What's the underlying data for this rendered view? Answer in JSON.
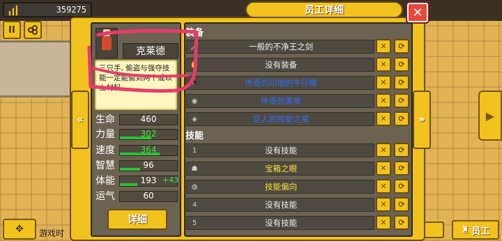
{
  "hud": {
    "money": "359275",
    "game_time_label": "游戏时"
  },
  "dialog": {
    "title": "员工详细",
    "close_label": "✕"
  },
  "employee": {
    "name": "克莱德",
    "description": "三只手, 偷盗与强夺技能一定能偷到两个或以上材料",
    "stats": [
      {
        "label": "生命",
        "value": "460",
        "value_color": "white",
        "level": 0.0
      },
      {
        "label": "力量",
        "value": "302",
        "value_color": "green",
        "level": 0.55
      },
      {
        "label": "速度",
        "value": "364",
        "value_color": "green",
        "level": 0.7
      },
      {
        "label": "智慧",
        "value": "96",
        "value_color": "white",
        "level": 0.35
      },
      {
        "label": "体能",
        "value": "193",
        "bonus": "+43",
        "value_color": "white",
        "level": 0.3
      },
      {
        "label": "运气",
        "value": "60",
        "value_color": "white",
        "level": 0.0
      }
    ],
    "detail_button": "详细"
  },
  "equipment": {
    "header": "装备",
    "items": [
      {
        "icon": "sword-icon",
        "name": "一般的不净王之剑",
        "color": "white"
      },
      {
        "icon": "glove-icon",
        "name": "没有装备",
        "color": "white"
      },
      {
        "icon": "hat-icon",
        "name": "传奇的印地的牛仔帽",
        "color": "blue"
      },
      {
        "icon": "belt-icon",
        "name": "传奇的黑带",
        "color": "blue"
      },
      {
        "icon": "ring-icon",
        "name": "巨人的技能之戒",
        "color": "blue"
      }
    ]
  },
  "skills": {
    "header": "技能",
    "items": [
      {
        "icon": "slot-1",
        "slot": "1",
        "name": "没有技能",
        "color": "white"
      },
      {
        "icon": "chest-eye-icon",
        "slot": "",
        "name": "宝箱之眼",
        "color": "yellow"
      },
      {
        "icon": "globe-icon",
        "slot": "",
        "name": "技能偏向",
        "color": "yellow"
      },
      {
        "icon": "slot-4",
        "slot": "4",
        "name": "没有技能",
        "color": "white"
      },
      {
        "icon": "slot-5",
        "slot": "5",
        "name": "没有技能",
        "color": "white"
      }
    ]
  },
  "buttons": {
    "remove_glyph": "✕",
    "swap_glyph": "⟳",
    "prev_glyph": "«",
    "next_glyph": "»",
    "pause_glyph": "II",
    "staff_label": "员工"
  },
  "colors": {
    "panel_yellow": "#f2c21e",
    "panel_dark": "#6b6252",
    "legendary_blue": "#2f6cff",
    "skill_yellow": "#f5e13a",
    "stat_green": "#3fe03f",
    "close_red": "#e8473a",
    "annotation_red": "#e83a6a"
  }
}
